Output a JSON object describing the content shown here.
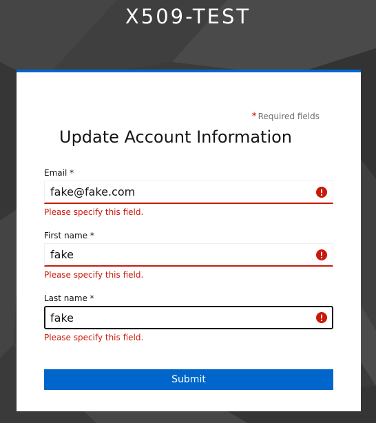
{
  "realm": {
    "title": "X509-TEST"
  },
  "form": {
    "required_star": "*",
    "required_note": "Required fields",
    "title": "Update Account Information",
    "fields": [
      {
        "label": "Email *",
        "value": "fake@fake.com",
        "error": "Please specify this field.",
        "icon": "exclamation-circle-icon"
      },
      {
        "label": "First name *",
        "value": "fake",
        "error": "Please specify this field.",
        "icon": "exclamation-circle-icon"
      },
      {
        "label": "Last name *",
        "value": "fake",
        "error": "Please specify this field.",
        "icon": "exclamation-circle-icon"
      }
    ],
    "submit_label": "Submit"
  },
  "colors": {
    "accent": "#0066cc",
    "error": "#c9190b",
    "text": "#151515",
    "muted": "#6a6e73"
  }
}
